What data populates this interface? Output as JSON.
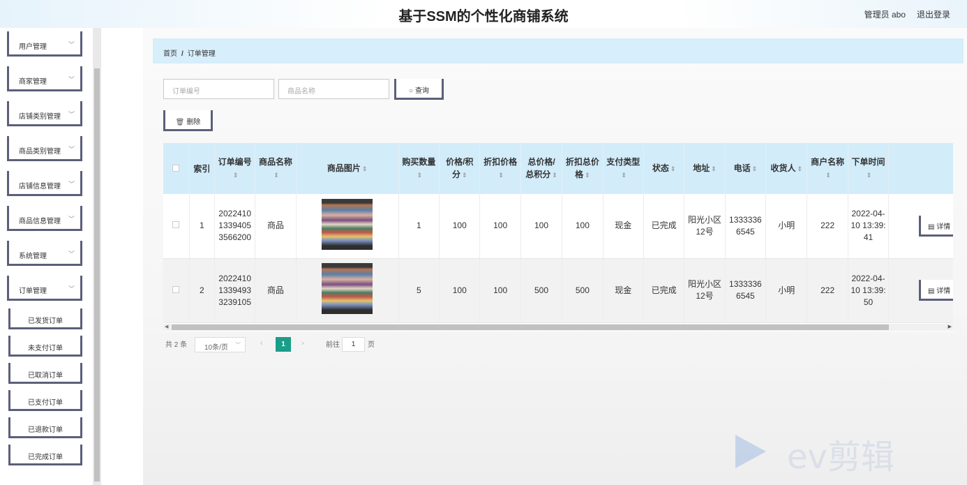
{
  "header": {
    "title": "基于SSM的个性化商铺系统",
    "user": "管理员 abo",
    "logout": "退出登录"
  },
  "sidebar": {
    "menus": [
      {
        "label": "用户管理",
        "icon": "chevron-down-icon"
      },
      {
        "label": "商家管理",
        "icon": "chevron-down-icon"
      },
      {
        "label": "店铺类别管理",
        "icon": "chevron-down-icon"
      },
      {
        "label": "商品类别管理",
        "icon": "chevron-down-icon"
      },
      {
        "label": "店铺信息管理",
        "icon": "chevron-down-icon"
      },
      {
        "label": "商品信息管理",
        "icon": "chevron-down-icon"
      },
      {
        "label": "系统管理",
        "icon": "chevron-down-icon"
      },
      {
        "label": "订单管理",
        "icon": "chevron-up-icon"
      }
    ],
    "submenus": [
      "已发货订单",
      "未支付订单",
      "已取消订单",
      "已支付订单",
      "已退款订单",
      "已完成订单"
    ]
  },
  "breadcrumb": {
    "home": "首页",
    "sep": "/",
    "current": "订单管理"
  },
  "search": {
    "order_no_placeholder": "订单编号",
    "product_name_placeholder": "商品名称",
    "query_label": "查询",
    "delete_label": "删除"
  },
  "table": {
    "headers": {
      "index": "索引",
      "order_no": "订单编号",
      "product_name": "商品名称",
      "product_image": "商品图片",
      "quantity": "购买数量",
      "price": "价格/积分",
      "discount_price": "折扣价格",
      "total_price": "总价格/总积分",
      "discount_total": "折扣总价格",
      "pay_type": "支付类型",
      "status": "状态",
      "address": "地址",
      "phone": "电话",
      "receiver": "收货人",
      "merchant": "商户名称",
      "order_time": "下单时间"
    },
    "sort_icon": "⇕",
    "detail_label": "详情",
    "rows": [
      {
        "index": "1",
        "order_no": "202241013394053566200",
        "product_name": "商品",
        "quantity": "1",
        "price": "100",
        "discount_price": "100",
        "total_price": "100",
        "discount_total": "100",
        "pay_type": "现金",
        "status": "已完成",
        "address": "阳光小区12号",
        "phone": "13333366545",
        "receiver": "小明",
        "merchant": "222",
        "order_time": "2022-04-10 13:39:41"
      },
      {
        "index": "2",
        "order_no": "202241013394933239105",
        "product_name": "商品",
        "quantity": "5",
        "price": "100",
        "discount_price": "100",
        "total_price": "500",
        "discount_total": "500",
        "pay_type": "现金",
        "status": "已完成",
        "address": "阳光小区12号",
        "phone": "13333366545",
        "receiver": "小明",
        "merchant": "222",
        "order_time": "2022-04-10 13:39:50"
      }
    ]
  },
  "pagination": {
    "total": "共 2 条",
    "page_size": "10条/页",
    "current_page": "1",
    "goto_label": "前往",
    "goto_value": "1",
    "page_suffix": "页"
  },
  "watermark": "ev剪辑"
}
